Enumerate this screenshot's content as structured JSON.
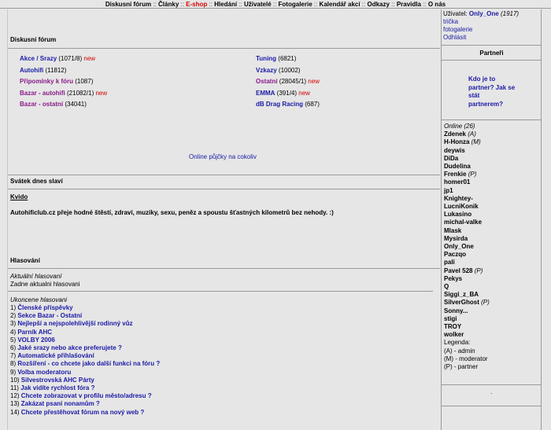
{
  "nav": {
    "items": [
      "Diskusní fórum",
      "Články",
      "E-shop",
      "Hledání",
      "Uživatelé",
      "Fotogalerie",
      "Kalendář akcí",
      "Odkazy",
      "Pravidla",
      "O nás"
    ],
    "separator": "::"
  },
  "forum": {
    "title": "Diskusní fórum",
    "left": [
      {
        "name": "Akce / Srazy",
        "count": "(1071/8)",
        "new": "new"
      },
      {
        "name": "Autohifi",
        "count": "(11812)",
        "new": ""
      },
      {
        "name": "Připomínky k fóru",
        "count": "(1087)",
        "new": ""
      },
      {
        "name": "Bazar - autohifi",
        "count": "(21082/1)",
        "new": "new"
      },
      {
        "name": "Bazar - ostatní",
        "count": "(34041)",
        "new": ""
      }
    ],
    "right": [
      {
        "name": "Tuning",
        "count": "(6821)",
        "new": ""
      },
      {
        "name": "Vzkazy",
        "count": "(10002)",
        "new": ""
      },
      {
        "name": "Ostatní",
        "count": "(28045/1)",
        "new": "new"
      },
      {
        "name": "EMMA",
        "count": "(391/4)",
        "new": "new"
      },
      {
        "name": "dB Drag Racing",
        "count": "(687)",
        "new": ""
      }
    ],
    "ad_link": "Online půjčky na cokoliv"
  },
  "holiday": {
    "title": "Svátek dnes slaví",
    "name": "Kvido",
    "message": "Autohificlub.cz přeje hodné štěstí, zdraví, muziky, sexu, peněz a spoustu šťastných kilometrů bez nehody. :)"
  },
  "polls": {
    "title": "Hlasování",
    "current_heading": "Aktuální hlasovaní",
    "current_text": "Zadne aktualni hlasovani",
    "finished_heading": "Ukoncene hlasovani",
    "finished": [
      {
        "num": "1)",
        "label": "Členské příspěvky"
      },
      {
        "num": "2)",
        "label": "Sekce Bazar - Ostatní"
      },
      {
        "num": "3)",
        "label": "Nejlepší a nejspolehlivější rodinný vůz"
      },
      {
        "num": "4)",
        "label": "Parník AHC"
      },
      {
        "num": "5)",
        "label": "VOLBY 2006"
      },
      {
        "num": "6)",
        "label": "Jaké srazy nebo akce preferujete ?"
      },
      {
        "num": "7)",
        "label": "Automatické přihlašování"
      },
      {
        "num": "8)",
        "label": "Rozšíření - co chcete jako další funkci na fóru ?"
      },
      {
        "num": "9)",
        "label": "Volba moderatoru"
      },
      {
        "num": "10)",
        "label": "Silvestrovská AHC Párty"
      },
      {
        "num": "11)",
        "label": "Jak vidíte rychlost fóra ?"
      },
      {
        "num": "12)",
        "label": "Chcete zobrazovat v profilu město/adresu ?"
      },
      {
        "num": "13)",
        "label": "Zakázat psaní nonamům ?"
      },
      {
        "num": "14)",
        "label": "Chcete přestěhovat fórum na nový web ?"
      }
    ]
  },
  "sidebar": {
    "user_label": "Uživatel:",
    "user_name": "Only_One",
    "user_count": "(1917)",
    "links": [
      "trička",
      "fotogalerie",
      "Odhlásit"
    ],
    "partners_title": "Partneři",
    "partner_link": "Kdo je to partner? Jak se stát partnerem?",
    "online_heading": "Online",
    "online_count": "(26)",
    "online_users": [
      {
        "name": "Zdenek",
        "role": "(A)"
      },
      {
        "name": "H-Honza",
        "role": "(M)"
      },
      {
        "name": "deywis",
        "role": ""
      },
      {
        "name": "DiDa",
        "role": ""
      },
      {
        "name": "Dudelina",
        "role": ""
      },
      {
        "name": "Frenkie",
        "role": "(P)"
      },
      {
        "name": "homer01",
        "role": ""
      },
      {
        "name": "jp1",
        "role": ""
      },
      {
        "name": "Knightey-",
        "role": ""
      },
      {
        "name": "LucniKonik",
        "role": ""
      },
      {
        "name": "Lukasino",
        "role": ""
      },
      {
        "name": "michal-valke",
        "role": ""
      },
      {
        "name": "Mlask",
        "role": ""
      },
      {
        "name": "Mysirda",
        "role": ""
      },
      {
        "name": "Only_One",
        "role": ""
      },
      {
        "name": "Paczqo",
        "role": ""
      },
      {
        "name": "pali",
        "role": ""
      },
      {
        "name": "Pavel 528",
        "role": "(P)"
      },
      {
        "name": "Pekys",
        "role": ""
      },
      {
        "name": "Q",
        "role": ""
      },
      {
        "name": "Siggi_z_BA",
        "role": ""
      },
      {
        "name": "SilverGhost",
        "role": "(P)"
      },
      {
        "name": "Sonny...",
        "role": ""
      },
      {
        "name": "stigi",
        "role": ""
      },
      {
        "name": "TROY",
        "role": ""
      },
      {
        "name": "wolker",
        "role": ""
      }
    ],
    "legend_title": "Legenda:",
    "legend": [
      "(A) - admin",
      "(M) - moderator",
      "(P) - partner"
    ],
    "dot": "."
  },
  "colors": {
    "link": "#1a1aa6",
    "new": "#d40000",
    "purple": "#8a1a8a",
    "background": "#e6e6e6"
  }
}
